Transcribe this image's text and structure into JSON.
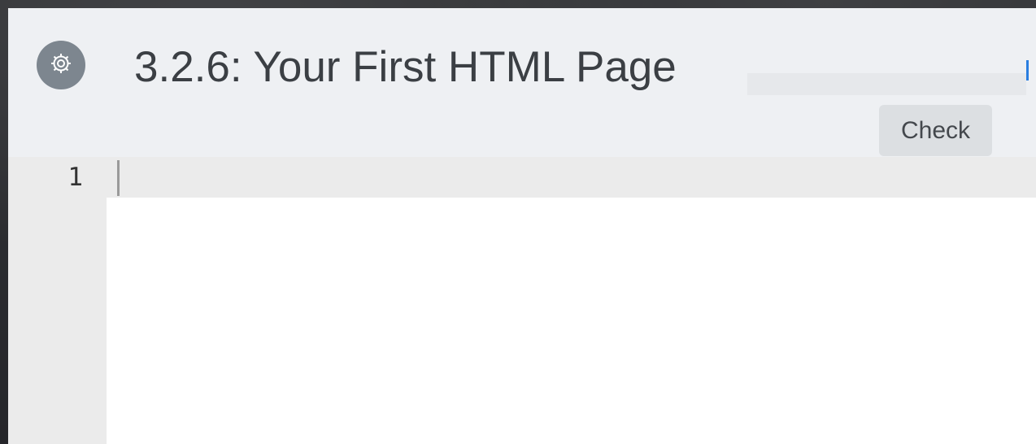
{
  "header": {
    "settings_icon": "gear-icon",
    "title": "3.2.6: Your First HTML Page",
    "check_label": "Check"
  },
  "editor": {
    "lines": [
      {
        "number": "1",
        "content": ""
      }
    ]
  },
  "colors": {
    "header_background": "#eef0f3",
    "settings_circle": "#7d868f",
    "check_button": "#dcdfe2",
    "gutter": "#ebebeb",
    "accent_marker": "#2a7ee0"
  }
}
